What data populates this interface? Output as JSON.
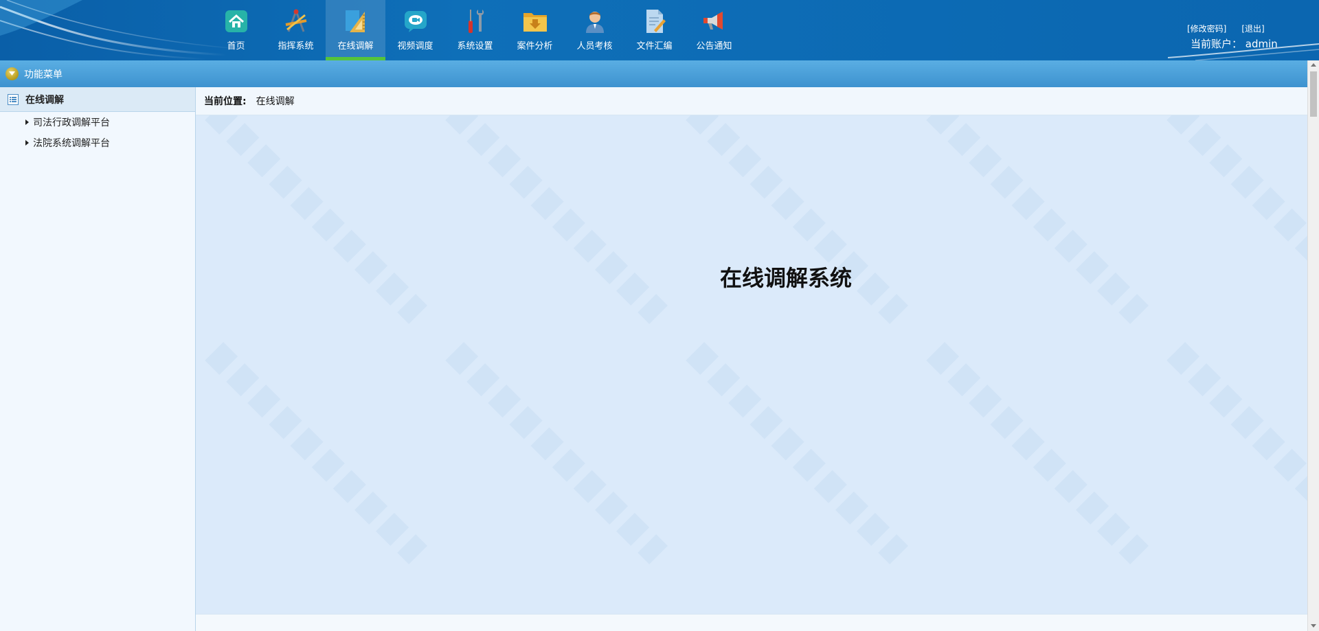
{
  "header": {
    "nav": [
      {
        "label": "首页",
        "icon": "home-icon"
      },
      {
        "label": "指挥系统",
        "icon": "compass-icon"
      },
      {
        "label": "在线调解",
        "icon": "ruler-icon",
        "active": true
      },
      {
        "label": "视频调度",
        "icon": "chat-icon"
      },
      {
        "label": "系统设置",
        "icon": "tools-icon"
      },
      {
        "label": "案件分析",
        "icon": "folder-icon"
      },
      {
        "label": "人员考核",
        "icon": "person-icon"
      },
      {
        "label": "文件汇编",
        "icon": "document-icon"
      },
      {
        "label": "公告通知",
        "icon": "megaphone-icon"
      }
    ],
    "change_password": "[修改密码]",
    "logout": "[退出]",
    "account": "当前账户： admin"
  },
  "subbar": {
    "label": "功能菜单"
  },
  "sidebar": {
    "group_label": "在线调解",
    "items": [
      {
        "label": "司法行政调解平台"
      },
      {
        "label": "法院系统调解平台"
      }
    ]
  },
  "main": {
    "breadcrumb_label": "当前位置:",
    "breadcrumb_value": "在线调解",
    "title": "在线调解系统"
  },
  "colors": {
    "header_bg": "#0e6fb8",
    "active_indicator": "#55c43b",
    "subbar_bg": "#3d92cf",
    "content_bg": "#dbeafa"
  }
}
